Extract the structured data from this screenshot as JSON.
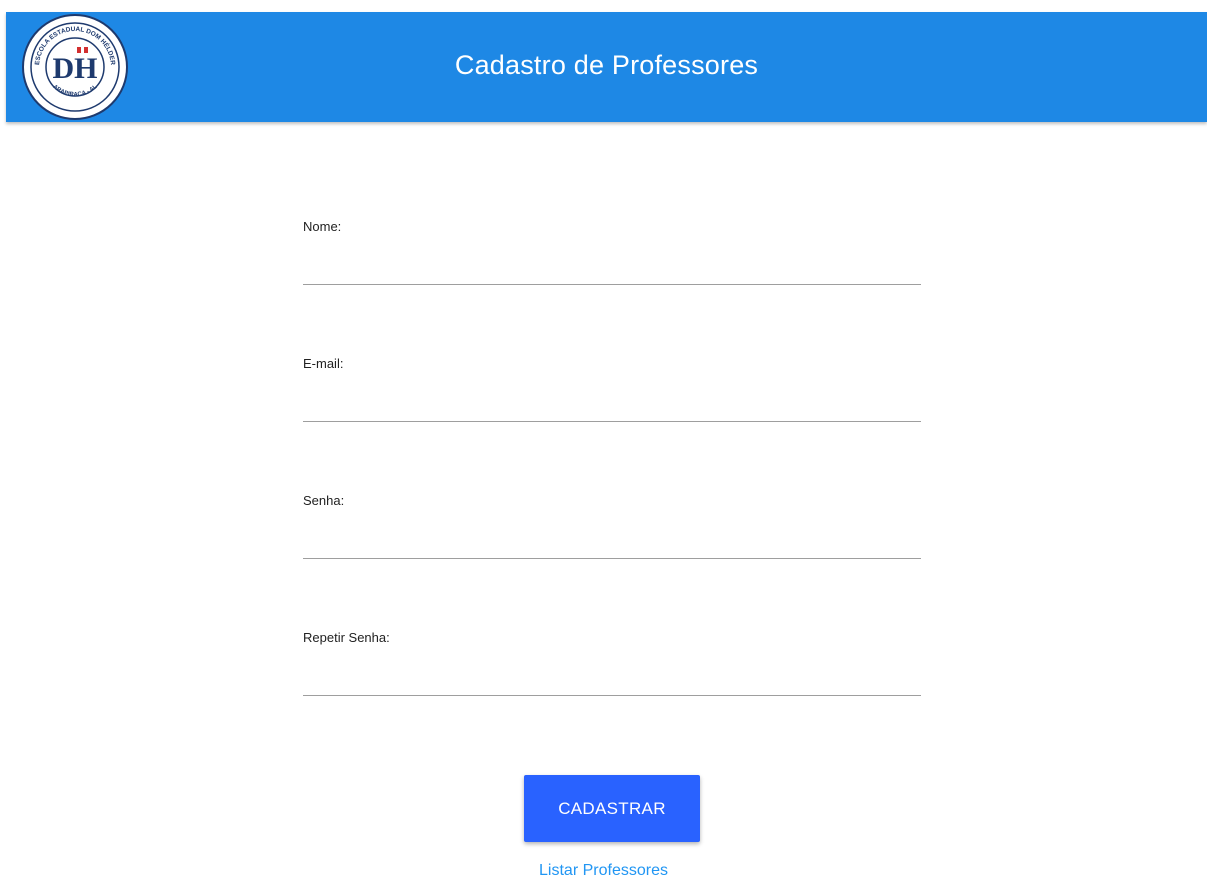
{
  "header": {
    "title": "Cadastro de Professores",
    "logo": {
      "initials": "DH",
      "ring_text_top": "ESCOLA ESTADUAL DOM HÉLDER",
      "ring_text_bottom": "ARAPIRACA - AL"
    }
  },
  "form": {
    "fields": [
      {
        "label": "Nome:",
        "value": "",
        "type": "text"
      },
      {
        "label": "E-mail:",
        "value": "",
        "type": "email"
      },
      {
        "label": "Senha:",
        "value": "",
        "type": "password"
      },
      {
        "label": "Repetir Senha:",
        "value": "",
        "type": "password"
      }
    ],
    "submit_label": "CADASTRAR",
    "list_link_label": "Listar Professores"
  },
  "colors": {
    "header_bg": "#1e88e5",
    "button_bg": "#2962ff",
    "link": "#2196f3"
  }
}
